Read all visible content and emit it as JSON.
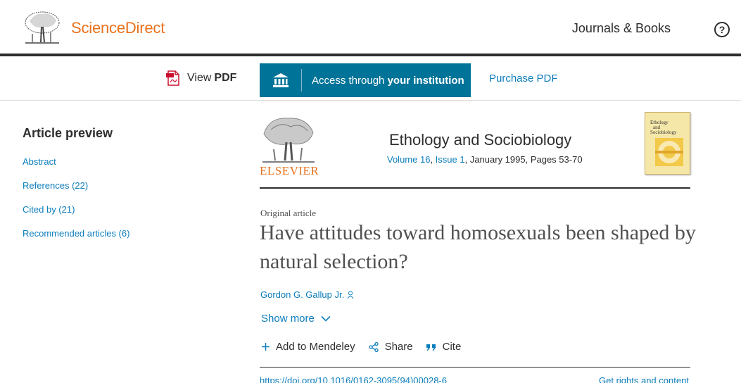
{
  "header": {
    "brand": "ScienceDirect",
    "journals_books": "Journals & Books",
    "help": "?"
  },
  "toolbar": {
    "view_pdf_prefix": "View",
    "view_pdf_bold": "PDF",
    "access_prefix": "Access through",
    "access_bold": "your institution",
    "purchase": "Purchase PDF"
  },
  "sidebar": {
    "title": "Article preview",
    "links": [
      "Abstract",
      "References (22)",
      "Cited by (21)",
      "Recommended articles (6)"
    ]
  },
  "journal": {
    "publisher": "ELSEVIER",
    "name": "Ethology and Sociobiology",
    "volume": "Volume 16",
    "issue": "Issue 1",
    "rest": ", January 1995, Pages 53-70",
    "cover_title": "Ethology and Sociobiology"
  },
  "article": {
    "type": "Original article",
    "title": "Have attitudes toward homosexuals been shaped by natural selection?",
    "author": "Gordon G. Gallup Jr.",
    "show_more": "Show more",
    "actions": [
      "Add to Mendeley",
      "Share",
      "Cite"
    ],
    "doi": "https://doi.org/10.1016/0162-3095(94)00028-6",
    "rights": "Get rights and content"
  },
  "colors": {
    "brand_orange": "#e9711c",
    "link_blue": "#0c7dbb",
    "access_teal": "#007398"
  },
  "icons": [
    "elsevier-tree-logo",
    "pdf-icon",
    "institution-icon",
    "help-icon",
    "person-icon",
    "chevron-down-icon",
    "plus-icon",
    "share-icon",
    "quote-icon"
  ]
}
